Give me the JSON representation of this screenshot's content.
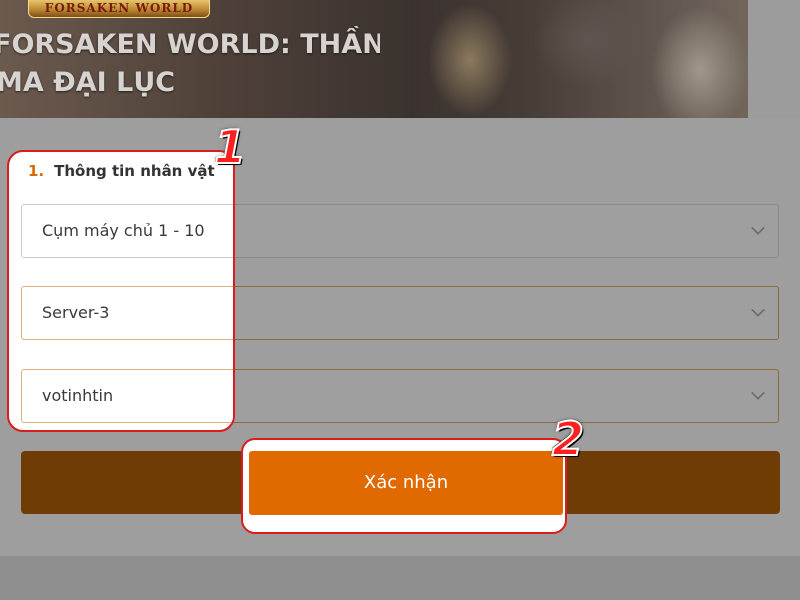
{
  "banner": {
    "logo_text": "FORSAKEN WORLD",
    "title_line1": "FORSAKEN WORLD: THẦN",
    "title_line2": "MA ĐẠI LỤC"
  },
  "form": {
    "section_number": "1.",
    "section_title": "Thông tin nhân vật",
    "server_cluster": "Cụm máy chủ 1 - 10",
    "server": "Server-3",
    "character": "votinhtin",
    "confirm_label": "Xác nhận"
  },
  "callouts": {
    "first": "1",
    "second": "2"
  },
  "colors": {
    "accent": "#e06a00",
    "callout": "#ff1f1f",
    "highlight_border": "#d91c1c"
  }
}
